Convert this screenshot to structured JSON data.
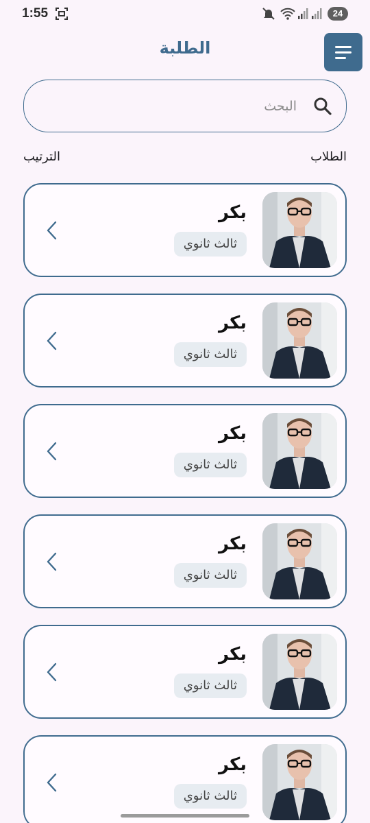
{
  "status_bar": {
    "time": "1:55",
    "battery": "24"
  },
  "header": {
    "title": "الطلبة"
  },
  "search": {
    "placeholder": "البحث"
  },
  "section": {
    "students_label": "الطلاب",
    "sort_label": "الترتيب"
  },
  "students": [
    {
      "name": "بكر",
      "grade": "ثالث ثانوي"
    },
    {
      "name": "بكر",
      "grade": "ثالث ثانوي"
    },
    {
      "name": "بكر",
      "grade": "ثالث ثانوي"
    },
    {
      "name": "بكر",
      "grade": "ثالث ثانوي"
    },
    {
      "name": "بكر",
      "grade": "ثالث ثانوي"
    },
    {
      "name": "بكر",
      "grade": "ثالث ثانوي"
    }
  ],
  "colors": {
    "primary": "#3f6b8e",
    "background": "#fbf4fb",
    "badge": "#e7ecf1"
  }
}
